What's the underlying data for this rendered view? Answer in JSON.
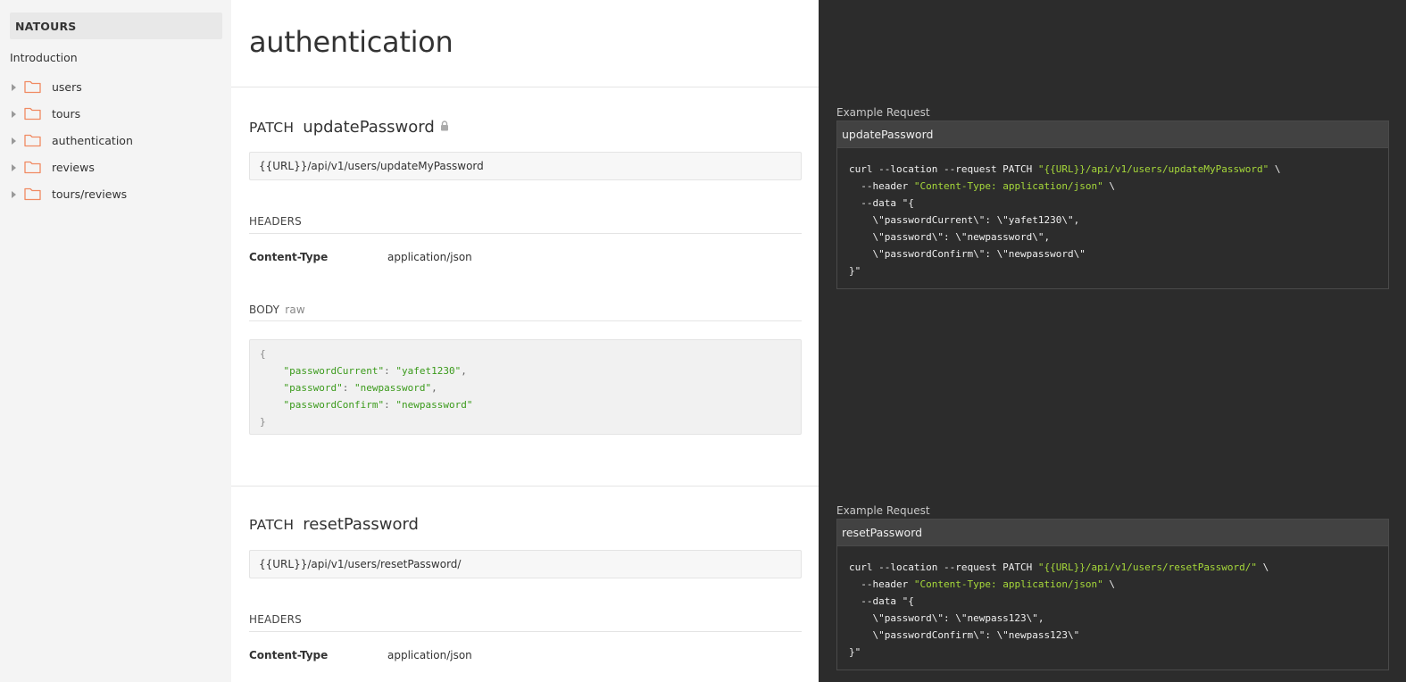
{
  "sidebar": {
    "brand": "NATOURS",
    "intro": "Introduction",
    "folders": [
      {
        "label": "users"
      },
      {
        "label": "tours"
      },
      {
        "label": "authentication"
      },
      {
        "label": "reviews"
      },
      {
        "label": "tours/reviews"
      }
    ]
  },
  "main": {
    "title": "authentication",
    "requests": [
      {
        "method": "PATCH",
        "name": "updatePassword",
        "url": "{{URL}}/api/v1/users/updateMyPassword",
        "headers_label": "HEADERS",
        "header_key": "Content-Type",
        "header_value": "application/json",
        "body_label": "BODY",
        "body_mode": "raw",
        "body": {
          "open": "{",
          "lines": [
            {
              "key": "\"passwordCurrent\"",
              "sep": ": ",
              "value": "\"yafet1230\"",
              "tail": ","
            },
            {
              "key": "\"password\"",
              "sep": ": ",
              "value": "\"newpassword\"",
              "tail": ","
            },
            {
              "key": "\"passwordConfirm\"",
              "sep": ": ",
              "value": "\"newpassword\"",
              "tail": ""
            }
          ],
          "close": "}"
        }
      },
      {
        "method": "PATCH",
        "name": "resetPassword",
        "url": "{{URL}}/api/v1/users/resetPassword/",
        "headers_label": "HEADERS",
        "header_key": "Content-Type",
        "header_value": "application/json"
      }
    ]
  },
  "examples": [
    {
      "label": "Example Request",
      "name": "updatePassword",
      "lines": [
        {
          "pre": "curl --location --request PATCH ",
          "str": "\"{{URL}}/api/v1/users/updateMyPassword\"",
          "post": " \\"
        },
        {
          "pre": "  --header ",
          "str": "\"Content-Type: application/json\"",
          "post": " \\"
        },
        {
          "pre": "  --data \"{",
          "str": "",
          "post": ""
        },
        {
          "pre": "    \\\"passwordCurrent\\\": \\\"yafet1230\\\",",
          "str": "",
          "post": ""
        },
        {
          "pre": "    \\\"password\\\": \\\"newpassword\\\",",
          "str": "",
          "post": ""
        },
        {
          "pre": "    \\\"passwordConfirm\\\": \\\"newpassword\\\"",
          "str": "",
          "post": ""
        },
        {
          "pre": "}\"",
          "str": "",
          "post": ""
        }
      ]
    },
    {
      "label": "Example Request",
      "name": "resetPassword",
      "lines": [
        {
          "pre": "curl --location --request PATCH ",
          "str": "\"{{URL}}/api/v1/users/resetPassword/\"",
          "post": " \\"
        },
        {
          "pre": "  --header ",
          "str": "\"Content-Type: application/json\"",
          "post": " \\"
        },
        {
          "pre": "  --data \"{",
          "str": "",
          "post": ""
        },
        {
          "pre": "    \\\"password\\\": \\\"newpass123\\\",",
          "str": "",
          "post": ""
        },
        {
          "pre": "    \\\"passwordConfirm\\\": \\\"newpass123\\\"",
          "str": "",
          "post": ""
        },
        {
          "pre": "}\"",
          "str": "",
          "post": ""
        }
      ]
    }
  ],
  "colors": {
    "folder_icon": "#f08a62",
    "json_string": "#3a9a1a",
    "curl_string": "#a6d83a",
    "dark_panel": "#2c2c2c"
  },
  "icons": {
    "folder": "folder-icon",
    "lock": "lock-icon",
    "caret": "caret-right-icon"
  }
}
